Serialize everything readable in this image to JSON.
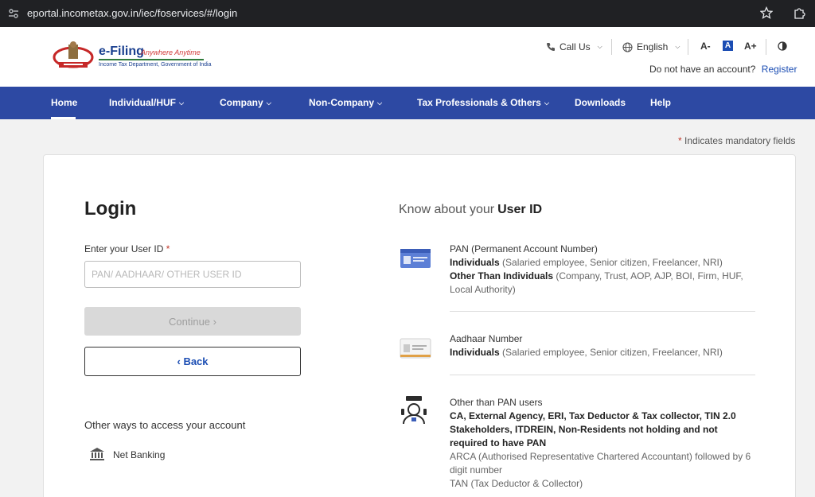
{
  "browser": {
    "url": "eportal.incometax.gov.in/iec/foservices/#/login"
  },
  "header": {
    "brand_main": "e-Filing",
    "brand_tagline": "Anywhere Anytime",
    "brand_sub": "Income Tax Department, Government of India",
    "call_us": "Call Us",
    "language": "English",
    "font_decrease": "A-",
    "font_normal": "A",
    "font_increase": "A+",
    "no_account_text": "Do not have an account?",
    "register_label": "Register"
  },
  "nav": {
    "items": [
      {
        "label": "Home"
      },
      {
        "label": "Individual/HUF"
      },
      {
        "label": "Company"
      },
      {
        "label": "Non-Company"
      },
      {
        "label": "Tax Professionals & Others"
      },
      {
        "label": "Downloads"
      },
      {
        "label": "Help"
      }
    ]
  },
  "mandatory": {
    "star": "*",
    "text": "Indicates mandatory fields"
  },
  "login": {
    "title": "Login",
    "userid_label": "Enter your User ID",
    "required_star": "*",
    "userid_placeholder": "PAN/ AADHAAR/ OTHER USER ID",
    "userid_value": "",
    "continue_label": "Continue",
    "back_label": "Back",
    "other_ways": "Other ways to access your account",
    "net_banking": "Net Banking"
  },
  "know": {
    "title_prefix": "Know about your",
    "title_bold": "User ID",
    "pan": {
      "heading": "PAN (Permanent Account Number)",
      "l1_bold": "Individuals",
      "l1_muted": "(Salaried employee, Senior citizen, Freelancer, NRI)",
      "l2_bold": "Other Than Individuals",
      "l2_muted": "(Company, Trust, AOP, AJP, BOI, Firm, HUF, Local Authority)"
    },
    "aadhaar": {
      "heading": "Aadhaar Number",
      "l1_bold": "Individuals",
      "l1_muted": "(Salaried employee, Senior citizen, Freelancer, NRI)"
    },
    "other": {
      "heading": "Other than PAN users",
      "bold": "CA, External Agency, ERI, Tax Deductor & Tax collector, TIN 2.0 Stakeholders, ITDREIN, Non-Residents not holding and not required to have PAN",
      "muted1": "ARCA (Authorised Representative Chartered Accountant) followed by 6 digit number",
      "muted2": "TAN (Tax Deductor & Collector)"
    }
  },
  "colors": {
    "nav_bg": "#2d49a3",
    "link": "#1b4db3",
    "required": "#c0392b"
  }
}
